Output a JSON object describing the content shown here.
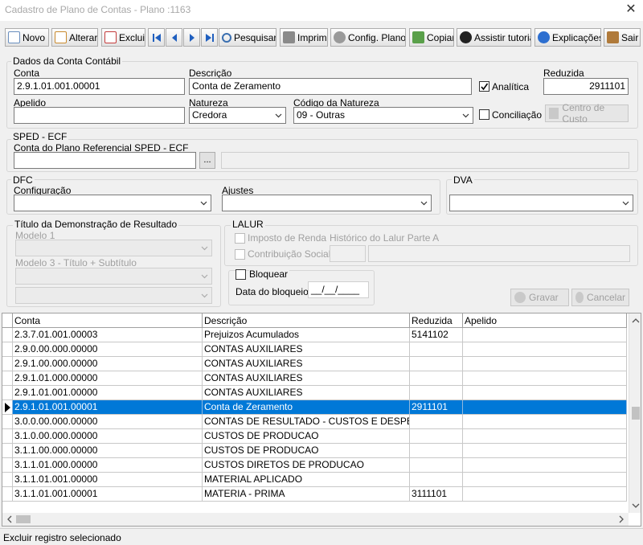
{
  "window": {
    "title": "Cadastro de Plano de Contas - Plano :1163",
    "close": "✕"
  },
  "toolbar": {
    "novo": "Novo",
    "alterar": "Alterar",
    "excluir": "Excluir",
    "pesquisar": "Pesquisar",
    "imprimir": "Imprimir",
    "config": "Config. Planos",
    "copiar": "Copiar",
    "tutorial": "Assistir tutorial",
    "explicacoes": "Explicações",
    "sair": "Sair"
  },
  "dados": {
    "legend": "Dados da Conta Contábil",
    "conta_label": "Conta",
    "conta_value": "2.9.1.01.001.00001",
    "descricao_label": "Descrição",
    "descricao_value": "Conta de Zeramento",
    "analitica_label": "Analítica",
    "analitica_checked": true,
    "reduzida_label": "Reduzida",
    "reduzida_value": "2911101",
    "apelido_label": "Apelido",
    "apelido_value": "",
    "natureza_label": "Natureza",
    "natureza_value": "Credora",
    "codigo_label": "Código da Natureza",
    "codigo_value": "09 - Outras",
    "conciliacao_label": "Conciliação",
    "conciliacao_checked": false,
    "centro_custo": "Centro de Custo"
  },
  "sped": {
    "legend": "SPED - ECF",
    "conta_label": "Conta do Plano Referencial SPED - ECF",
    "ellipsis": "..."
  },
  "dfc": {
    "legend": "DFC",
    "config_label": "Configuração",
    "ajustes_label": "Ajustes"
  },
  "dva": {
    "legend": "DVA"
  },
  "titulo": {
    "legend": "Título da Demonstração de Resultado",
    "modelo1": "Modelo 1",
    "modelo3": "Modelo 3 - Título + Subtítulo"
  },
  "lalur": {
    "legend": "LALUR",
    "imposto": "Imposto de Renda",
    "contribuicao": "Contribuição Social",
    "historico": "Histórico do Lalur Parte A"
  },
  "bloqueio": {
    "bloquear_label": "Bloquear",
    "data_label": "Data do bloqueio:",
    "data_value": "__/__/____"
  },
  "actions": {
    "gravar": "Gravar",
    "cancelar": "Cancelar"
  },
  "grid": {
    "headers": [
      "Conta",
      "Descrição",
      "Reduzida",
      "Apelido"
    ],
    "rows": [
      [
        "2.3.7.01.001.00003",
        "Prejuizos Acumulados",
        "5141102",
        ""
      ],
      [
        "2.9.0.00.000.00000",
        "CONTAS AUXILIARES",
        "",
        ""
      ],
      [
        "2.9.1.00.000.00000",
        "CONTAS AUXILIARES",
        "",
        ""
      ],
      [
        "2.9.1.01.000.00000",
        "CONTAS AUXILIARES",
        "",
        ""
      ],
      [
        "2.9.1.01.001.00000",
        "CONTAS AUXILIARES",
        "",
        ""
      ],
      [
        "2.9.1.01.001.00001",
        "Conta de Zeramento",
        "2911101",
        ""
      ],
      [
        "3.0.0.00.000.00000",
        "CONTAS DE RESULTADO - CUSTOS E DESPESAS",
        "",
        ""
      ],
      [
        "3.1.0.00.000.00000",
        "CUSTOS DE PRODUCAO",
        "",
        ""
      ],
      [
        "3.1.1.00.000.00000",
        "CUSTOS DE PRODUCAO",
        "",
        ""
      ],
      [
        "3.1.1.01.000.00000",
        "CUSTOS DIRETOS DE PRODUCAO",
        "",
        ""
      ],
      [
        "3.1.1.01.001.00000",
        "MATERIAL APLICADO",
        "",
        ""
      ],
      [
        "3.1.1.01.001.00001",
        "MATERIA - PRIMA",
        "3111101",
        ""
      ]
    ],
    "selected_index": 5
  },
  "status": "Excluir registro selecionado"
}
